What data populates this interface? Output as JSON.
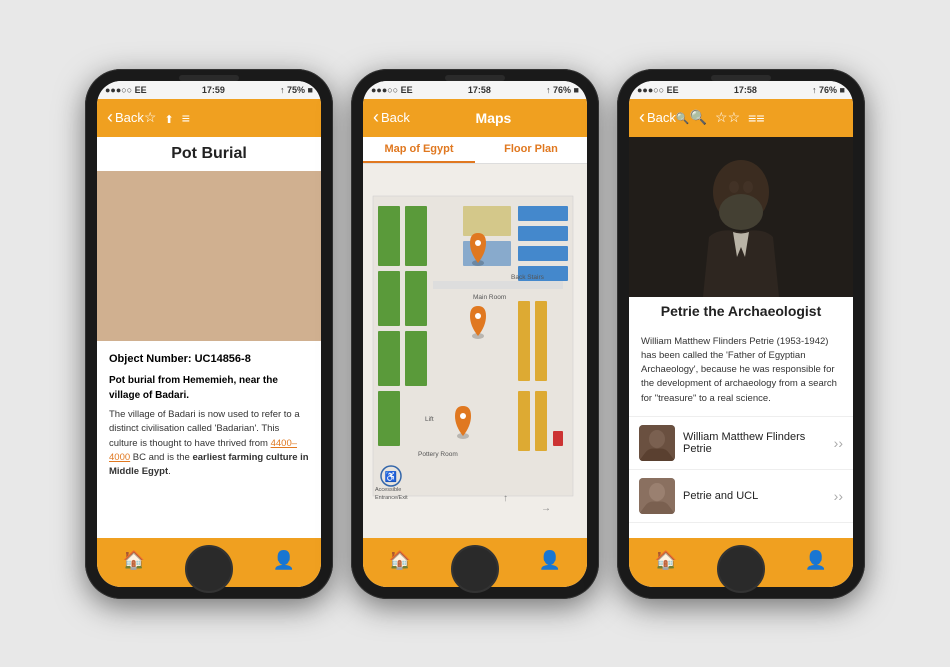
{
  "phone1": {
    "status": {
      "carrier": "●●●○○ EE",
      "time": "17:59",
      "battery": "↑ 75% ■"
    },
    "nav": {
      "back_label": "Back",
      "title": ""
    },
    "page_title": "Pot Burial",
    "content": {
      "object_number": "Object Number: UC14856-8",
      "description_title": "Pot burial from Hememieh, near the village of Badari.",
      "description_body": "The village of Badari is now used to refer to a distinct civilisation called 'Badarian'. This culture is thought to have thrived from ",
      "link_text": "4400–4000",
      "description_cont": " BC and is the ",
      "bold_text": "earliest farming culture in Middle Egypt",
      "period": "."
    },
    "tabs": [
      "🏠",
      "◎",
      "👤"
    ]
  },
  "phone2": {
    "status": {
      "carrier": "●●●○○ EE",
      "time": "17:58",
      "battery": "↑ 76% ■"
    },
    "nav": {
      "back_label": "Back",
      "title": "Maps"
    },
    "map_tabs": [
      "Map of Egypt",
      "Floor Plan"
    ],
    "labels": {
      "back_stairs": "Back Stairs",
      "main_room": "Main Room",
      "lift": "Lift",
      "pottery_room": "Pottery Room",
      "accessible": "Accessible Entrance/Exit"
    },
    "tabs": [
      "🏠",
      "◎",
      "👤"
    ]
  },
  "phone3": {
    "status": {
      "carrier": "●●●○○ EE",
      "time": "17:58",
      "battery": "↑ 76% ■"
    },
    "nav": {
      "back_label": "Back",
      "title": ""
    },
    "page_title": "Petrie the Archaeologist",
    "description": "William Matthew Flinders Petrie (1953-1942) has been called the 'Father of Egyptian Archaeology', because he was responsible for the development of archaeology from a search for \"treasure\" to a real science.",
    "list_items": [
      {
        "label": "William Matthew Flinders Petrie"
      },
      {
        "label": "Petrie and UCL"
      }
    ],
    "tabs": [
      "🏠",
      "◎",
      "👤"
    ]
  }
}
